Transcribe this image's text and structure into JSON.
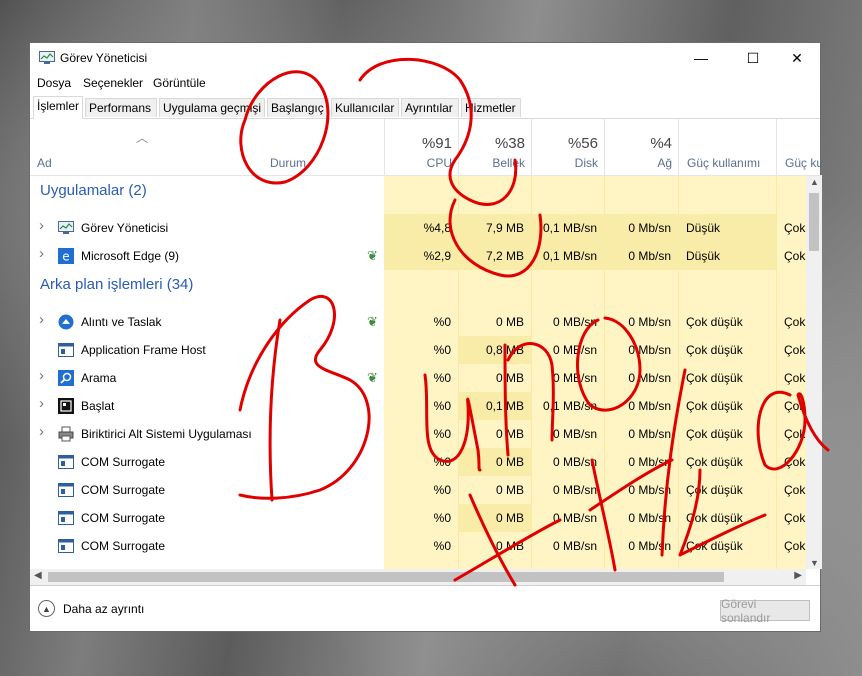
{
  "window": {
    "title": "Görev Yöneticisi",
    "controls": {
      "minimize": "—",
      "maximize": "☐",
      "close": "✕"
    }
  },
  "menu": [
    "Dosya",
    "Seçenekler",
    "Görüntüle"
  ],
  "tabs": [
    "İşlemler",
    "Performans",
    "Uygulama geçmişi",
    "Başlangıç",
    "Kullanıcılar",
    "Ayrıntılar",
    "Hizmetler"
  ],
  "columns": {
    "name": "Ad",
    "status": "Durum",
    "cpu": {
      "pct": "%91",
      "label": "CPU"
    },
    "memory": {
      "pct": "%38",
      "label": "Bellek"
    },
    "disk": {
      "pct": "%56",
      "label": "Disk"
    },
    "network": {
      "pct": "%4",
      "label": "Ağ"
    },
    "power": "Güç kullanımı",
    "power_trend": "Güç ku"
  },
  "groups": [
    {
      "title": "Uygulamalar (2)",
      "rows": [
        {
          "name": "Görev Yöneticisi",
          "icon": "task-manager-icon",
          "expand": true,
          "leaf": false,
          "cpu": "%4,8",
          "mem": "7,9 MB",
          "disk": "0,1 MB/sn",
          "net": "0 Mb/sn",
          "power": "Düşük",
          "trend": "Çok"
        },
        {
          "name": "Microsoft Edge (9)",
          "icon": "edge-icon",
          "expand": true,
          "leaf": true,
          "cpu": "%2,9",
          "mem": "7,2 MB",
          "disk": "0,1 MB/sn",
          "net": "0 Mb/sn",
          "power": "Düşük",
          "trend": "Çok"
        }
      ]
    },
    {
      "title": "Arka plan işlemleri (34)",
      "rows": [
        {
          "name": "Alıntı ve Taslak",
          "icon": "snip-sketch-icon",
          "expand": true,
          "leaf": true,
          "cpu": "%0",
          "mem": "0 MB",
          "disk": "0 MB/sn",
          "net": "0 Mb/sn",
          "power": "Çok düşük",
          "trend": "Çok"
        },
        {
          "name": "Application Frame Host",
          "icon": "app-frame-icon",
          "expand": false,
          "leaf": false,
          "cpu": "%0",
          "mem": "0,8 MB",
          "disk": "0 MB/sn",
          "net": "0 Mb/sn",
          "power": "Çok düşük",
          "trend": "Çok"
        },
        {
          "name": "Arama",
          "icon": "search-icon",
          "expand": true,
          "leaf": true,
          "cpu": "%0",
          "mem": "0 MB",
          "disk": "0 MB/sn",
          "net": "0 Mb/sn",
          "power": "Çok düşük",
          "trend": "Çok"
        },
        {
          "name": "Başlat",
          "icon": "start-icon",
          "expand": true,
          "leaf": false,
          "cpu": "%0",
          "mem": "0,1 MB",
          "disk": "0,1 MB/sn",
          "net": "0 Mb/sn",
          "power": "Çok düşük",
          "trend": "Çok"
        },
        {
          "name": "Biriktirici Alt Sistemi Uygulaması",
          "icon": "printer-icon",
          "expand": true,
          "leaf": false,
          "cpu": "%0",
          "mem": "0 MB",
          "disk": "0 MB/sn",
          "net": "0 Mb/sn",
          "power": "Çok düşük",
          "trend": "Çok"
        },
        {
          "name": "COM Surrogate",
          "icon": "app-frame-icon",
          "expand": false,
          "leaf": false,
          "cpu": "%0",
          "mem": "0 MB",
          "disk": "0 MB/sn",
          "net": "0 Mb/sn",
          "power": "Çok düşük",
          "trend": "Çok"
        },
        {
          "name": "COM Surrogate",
          "icon": "app-frame-icon",
          "expand": false,
          "leaf": false,
          "cpu": "%0",
          "mem": "0 MB",
          "disk": "0 MB/sn",
          "net": "0 Mb/sn",
          "power": "Çok düşük",
          "trend": "Çok"
        },
        {
          "name": "COM Surrogate",
          "icon": "app-frame-icon",
          "expand": false,
          "leaf": false,
          "cpu": "%0",
          "mem": "0 MB",
          "disk": "0 MB/sn",
          "net": "0 Mb/sn",
          "power": "Çok düşük",
          "trend": "Çok"
        },
        {
          "name": "COM Surrogate",
          "icon": "app-frame-icon",
          "expand": false,
          "leaf": false,
          "cpu": "%0",
          "mem": "0 MB",
          "disk": "0 MB/sn",
          "net": "0 Mb/sn",
          "power": "Çok düşük",
          "trend": "Çok"
        }
      ]
    }
  ],
  "footer": {
    "less_details": "Daha az ayrıntı",
    "end_task": "Görevi sonlandır"
  },
  "colors": {
    "heat_light": "#fff4c4",
    "heat_dark": "#f9eca8",
    "group_title": "#2a5db0",
    "annotation": "#e00000"
  }
}
